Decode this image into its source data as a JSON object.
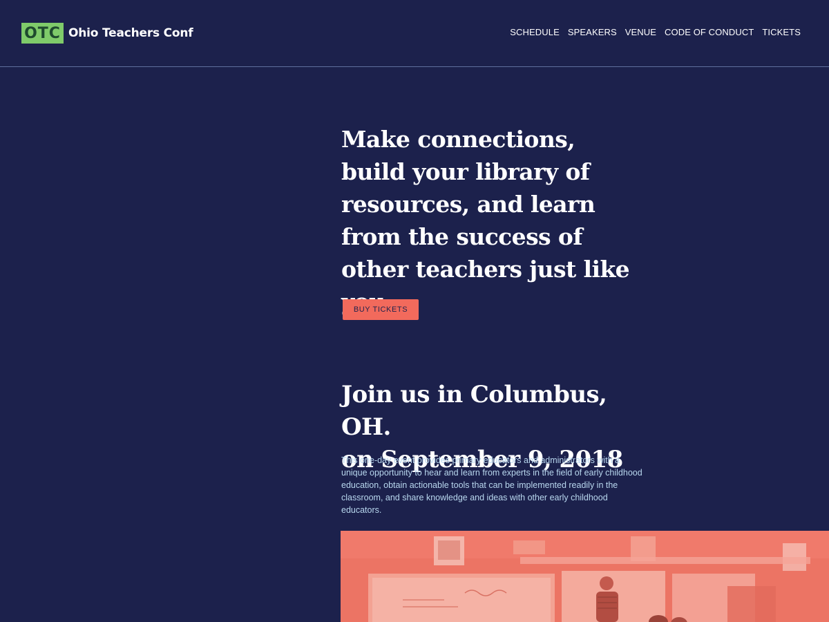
{
  "brand": {
    "badge": "OTC",
    "name": "Ohio Teachers Conf",
    "badge_color": "#7fcb6a"
  },
  "nav": {
    "items": [
      "SCHEDULE",
      "SPEAKERS",
      "VENUE",
      "CODE OF CONDUCT",
      "TICKETS"
    ]
  },
  "hero": {
    "title": "Make connections, build your library of resources, and learn from the success of other teachers just like you.",
    "cta_label": "BUY TICKETS"
  },
  "event": {
    "title_line1": "Join us in Columbus, OH.",
    "title_line2": "on September 9, 2018",
    "description": "This one-day event provides primary educators and administrators with a unique opportunity to hear and learn from experts in the field of early childhood education, obtain actionable tools that can be implemented readily in the classroom, and share knowledge and ideas with other early childhood educators."
  },
  "colors": {
    "background": "#1c214c",
    "accent": "#f26a5c",
    "body_text": "#b9d8ef"
  },
  "photo": {
    "icon": "classroom-photo"
  }
}
